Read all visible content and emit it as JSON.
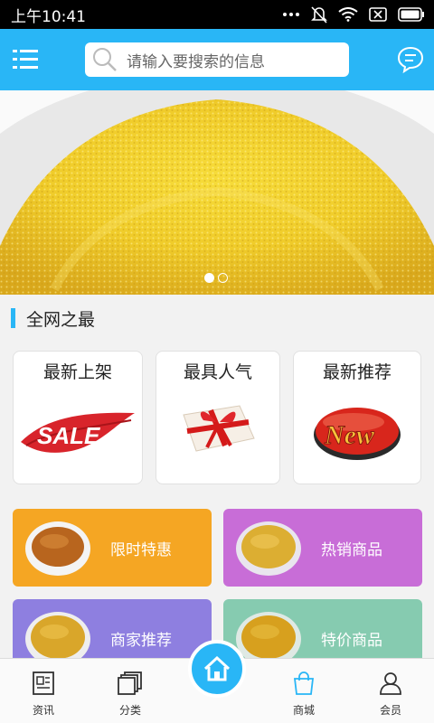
{
  "status_bar": {
    "time": "上午10:41"
  },
  "header": {
    "search_placeholder": "请输入要搜索的信息",
    "accent_color": "#29b6f6"
  },
  "banner": {
    "slides": 2,
    "active_slide": 1
  },
  "section": {
    "title": "全网之最"
  },
  "cards": [
    {
      "label": "最新上架",
      "icon": "sale-icon"
    },
    {
      "label": "最具人气",
      "icon": "gift-icon"
    },
    {
      "label": "最新推荐",
      "icon": "new-badge-icon"
    }
  ],
  "tiles": [
    {
      "label": "限时特惠",
      "color": "#f5a623"
    },
    {
      "label": "热销商品",
      "color": "#c86dd7"
    },
    {
      "label": "商家推荐",
      "color": "#8e7fe0"
    },
    {
      "label": "特价商品",
      "color": "#86cbb0"
    }
  ],
  "bottom_nav": [
    {
      "label": "资讯",
      "icon": "news-icon"
    },
    {
      "label": "分类",
      "icon": "category-icon"
    },
    {
      "label": "",
      "icon": "home-icon"
    },
    {
      "label": "商城",
      "icon": "shop-bag-icon",
      "active": true
    },
    {
      "label": "会员",
      "icon": "user-icon"
    }
  ]
}
